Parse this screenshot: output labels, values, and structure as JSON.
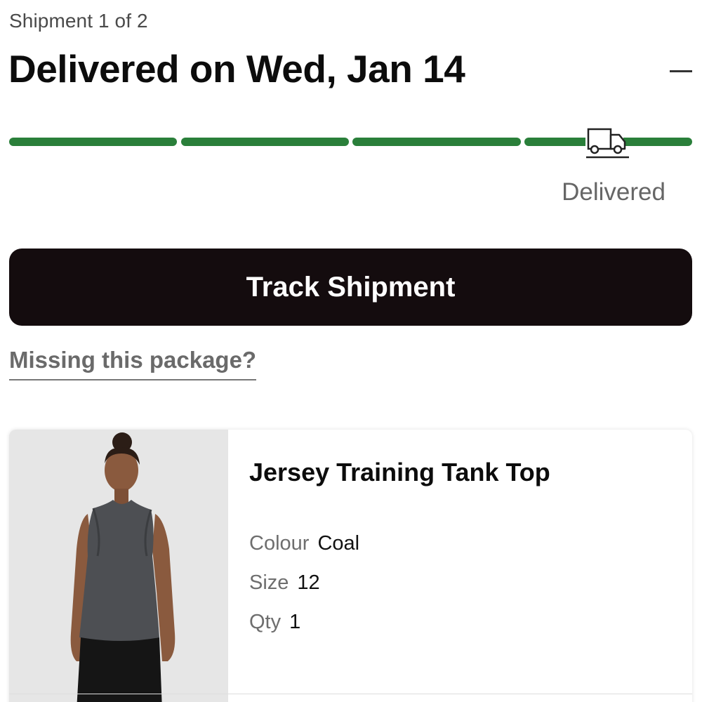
{
  "shipment": {
    "count_label": "Shipment 1 of 2",
    "title": "Delivered on Wed, Jan 14",
    "status_label": "Delivered",
    "progress": {
      "segments_total": 4,
      "segments_complete": 4,
      "color": "#2a7f3a"
    }
  },
  "icons": {
    "collapse": "minus-icon",
    "status": "truck-icon"
  },
  "actions": {
    "track_label": "Track Shipment",
    "missing_label": "Missing this package?"
  },
  "product": {
    "name": "Jersey Training Tank Top",
    "colour_label": "Colour",
    "colour_value": "Coal",
    "size_label": "Size",
    "size_value": "12",
    "qty_label": "Qty",
    "qty_value": "1"
  },
  "colors": {
    "button_bg": "#140c0e",
    "progress_green": "#2a7f3a",
    "muted_text": "#6e6e6e"
  }
}
